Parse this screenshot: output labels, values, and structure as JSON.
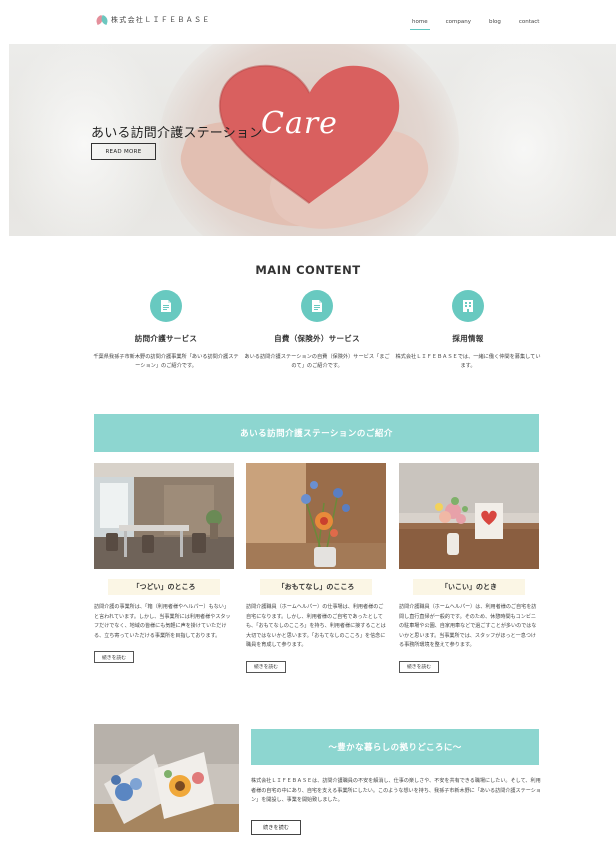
{
  "header": {
    "logo_text": "株式会社ＬＩＦＥＢＡＳＥ",
    "nav": [
      {
        "label": "home",
        "active": true
      },
      {
        "label": "company",
        "active": false
      },
      {
        "label": "blog",
        "active": false
      },
      {
        "label": "contact",
        "active": false
      }
    ]
  },
  "hero": {
    "title": "あいる訪問介護ステーション",
    "script": "Care",
    "button_label": "READ MORE"
  },
  "main": {
    "title": "MAIN CONTENT",
    "services": [
      {
        "icon": "document-icon",
        "title": "訪問介護サービス",
        "desc": "千葉県我孫子市新木野の訪問介護事業所「あいる訪問介護ステーション」のご紹介です。"
      },
      {
        "icon": "document-icon",
        "title": "自費（保険外）サービス",
        "desc": "あいる訪問介護ステーションの自費（保険外）サービス「まごのて」のご紹介です。"
      },
      {
        "icon": "building-icon",
        "title": "採用情報",
        "desc": "株式会社ＬＩＦＥＢＡＳＥでは、一緒に働く仲間を募集しています。"
      }
    ]
  },
  "intro": {
    "band_title": "あいる訪問介護ステーションのご紹介",
    "cards": [
      {
        "label": "「つどい」のところ",
        "text": "訪問介護の事業所は、「箱（利用者様やヘルパー）もない」と言われています。しかし、当事業所には利用者様やスタッフだけでなく、地域の皆様にも気軽に声を掛けていただける、立ち寄っていただける事業所を目指しております。",
        "more": "続きを読む"
      },
      {
        "label": "「おもてなし」のこころ",
        "text": "訪問介護職員（ホームヘルパー）の仕事場は、利用者様のご自宅になります。しかし、利用者様のご自宅であったとしても、「おもてなしのこころ」を持ち、利用者様に接することは大切ではないかと思います。「おもてなしのこころ」を信念に職員を育成して参ります。",
        "more": "続きを読む"
      },
      {
        "label": "「いこい」のとき",
        "text": "訪問介護職員（ホームヘルパー）は、利用者様のご自宅を訪問し直行直帰が一般的です。そのため、休憩時間もコンビニの駐車場や公園、自家用車などで過ごすことが多いのではないかと思います。当事業所では、スタッフがほっと一息つける事務所環境を整えて参ります。",
        "more": "続きを読む"
      }
    ]
  },
  "bottom": {
    "band_title": "〜豊かな暮らしの拠りどころに〜",
    "text": "株式会社ＬＩＦＥＢＡＳＥは、訪問介護職員の不安を解消し、仕事の楽しさや、不安を共有できる職場にしたい。そして、利用者様の自宅の中にあり、自宅を支える事業所にしたい。このような想いを持ち、我孫子市新木野に「あいる訪問介護ステーション」を開設し、事業を開始致しました。",
    "button_label": "続きを読む"
  },
  "colors": {
    "accent": "#68c9c0",
    "band": "#8dd6d0",
    "label_bg": "#fbf6e5",
    "heart": "#d9605f"
  }
}
